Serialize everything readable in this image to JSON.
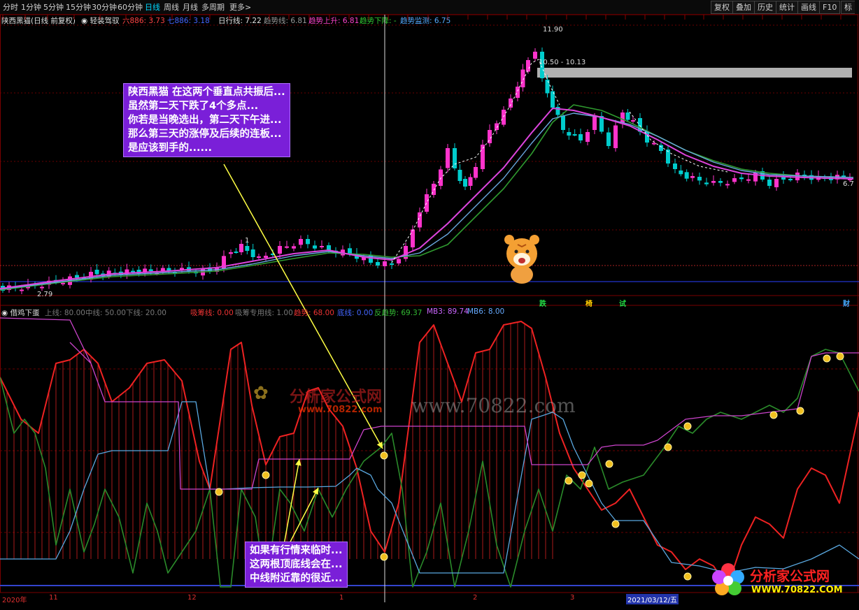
{
  "toolbar": {
    "tabs": [
      {
        "label": "分时",
        "active": false
      },
      {
        "label": "1分钟",
        "active": false
      },
      {
        "label": "5分钟",
        "active": false
      },
      {
        "label": "15分钟",
        "active": false
      },
      {
        "label": "30分钟",
        "active": false
      },
      {
        "label": "60分钟",
        "active": false
      },
      {
        "label": "日线",
        "active": true
      },
      {
        "label": "周线",
        "active": false
      },
      {
        "label": "月线",
        "active": false
      },
      {
        "label": "多周期",
        "active": false
      },
      {
        "label": "更多>",
        "active": false
      }
    ],
    "right_buttons": [
      "复权",
      "叠加",
      "历史",
      "统计",
      "画线",
      "F10",
      "标"
    ]
  },
  "main_info": {
    "stock": "陕西黑猫(日线 前复权)",
    "indicator_dropdown": "轻装驾驭",
    "ma6": "六886: 3.73",
    "ma7": "七886: 3.18",
    "day_line": "日行线: 7.22",
    "trend_line": "趋势线: 6.81",
    "trend_up": "趋势上升: 6.81",
    "trend_down": "趋势下降: -",
    "trend_watch": "趋势监测: 6.75"
  },
  "price_labels": {
    "high": "11.90",
    "range": "10.50 - 10.13",
    "low": "2.79",
    "last": "6.7",
    "peak_marker": "1"
  },
  "signals": [
    {
      "label": "跌",
      "color": "#22dd44"
    },
    {
      "label": "椅",
      "color": "#ffcc00"
    },
    {
      "label": "试",
      "color": "#22dd44"
    },
    {
      "label": "财",
      "color": "#44aaff"
    }
  ],
  "sub_info": {
    "name": "借鸡下蛋",
    "upper": "上线: 80.00",
    "middle": "中线: 50.00",
    "lower": "下线: 20.00",
    "absorb": "吸筹线: 0.00",
    "absorb_use": "吸筹专用线: 1.00",
    "top": "趋势: 68.00",
    "bottom": "底线: 0.00",
    "anti": "反趋势: 69.37",
    "mb3": "MB3: 89.74",
    "mb6": "MB6: 8.00"
  },
  "annotation_top": [
    "陕西黑猫 在这两个垂直点共振后...",
    "虽然第二天下跌了4个多点...",
    "你若是当晚选出，第二天下午进...",
    "那么第三天的涨停及后续的连板...",
    "是应该到手的......"
  ],
  "annotation_bottom": [
    "如果有行情来临时...",
    "这两根顶底线会在...",
    "中线附近靠的很近..."
  ],
  "watermark": {
    "brand": "分析家公式网",
    "url_small": "www.70822.com",
    "url_large": "www.70822.com",
    "logo_name": "分析家公式网",
    "logo_url": "WWW.70822.COM"
  },
  "date_axis": [
    "2020年",
    "11",
    "12",
    "1",
    "2",
    "3",
    "2021/03/12/五"
  ],
  "colors": {
    "bull": "#ff33cc",
    "bear": "#00cccc",
    "red_line": "#ee2222",
    "green_line": "#2a8a2a",
    "blue_line": "#5aa8e0",
    "magenta_line": "#cc44cc",
    "annotation_bg": "#7a1fd8",
    "arrow": "#ffff44"
  }
}
